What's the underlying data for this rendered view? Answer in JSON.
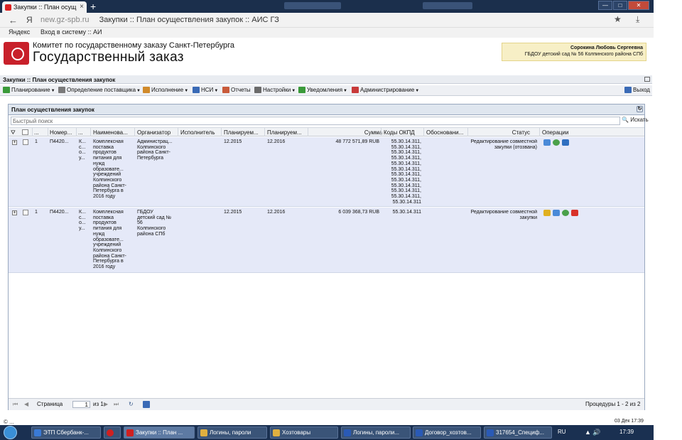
{
  "browser": {
    "tab_title": "Закупки :: План осущ",
    "new_tab": "+",
    "window_buttons": [
      "—",
      "□",
      "✕"
    ],
    "nav_back": "←",
    "ya_icon": "Я",
    "url_host": "new.gz-spb.ru",
    "url_title": "Закупки :: План осуществления закупок :: АИС ГЗ",
    "star": "★",
    "download": "⤓",
    "bookmarks": [
      "Яндекс",
      "Вход в систему :: АИ"
    ]
  },
  "app": {
    "header_line1": "Комитет по государственному заказу Санкт-Петербурга",
    "header_line2": "Государственный заказ",
    "user_name": "Сорокина Любовь Сергеевна",
    "user_org": "ГБДОУ детский сад № 56 Колпинского района СПб"
  },
  "panel_title": "Закупки :: План осуществления закупок",
  "menu": {
    "items": [
      "Планирование",
      "Определение поставщика",
      "Исполнение",
      "НСИ",
      "Отчеты",
      "Настройки",
      "Уведомления",
      "Администрирование"
    ],
    "exit": "Выход",
    "colors": [
      "#3a9a3a",
      "#7a7a7a",
      "#d08a2a",
      "#3a6ab6",
      "#c85a3a",
      "#6a6a6a",
      "#3a9a3a",
      "#c83a3a"
    ]
  },
  "grid": {
    "title": "План осуществления закупок",
    "search_placeholder": "Быстрый поиск",
    "search_button": "Искать",
    "columns": [
      "...",
      "Номер...",
      "...",
      "Наименова...",
      "Организатор",
      "Исполнитель",
      "Планируем...",
      "Планируем...",
      "Сумма",
      "Коды ОКПД",
      "Обосновани...",
      "Статус",
      "Операции"
    ],
    "rows": [
      {
        "num": "1",
        "number": "П4420...",
        "extra": "К... с... о... у...",
        "name": "Комплексная поставка продуктов питания для нужд образовате... учреждений Колпинского района Санкт-Петербурга в 2016 году",
        "organizer": "Администрац... Колпинского района Санкт-Петербурга",
        "executor": "",
        "plan1": "12.2015",
        "plan2": "12.2016",
        "sum": "48 772 571,89 RUB",
        "okpd": "55.30.14.311, 55.30.14.311, 55.30.14.311, 55.30.14.311, 55.30.14.311, 55.30.14.311, 55.30.14.311, 55.30.14.311, 55.30.14.311, 55.30.14.311, 55.30.14.311, 55.30.14.311",
        "reason": "",
        "status": "Редактирование совместной закупки (отозвана)",
        "ops": [
          "chart-icon",
          "refresh-icon",
          "list-icon"
        ]
      },
      {
        "num": "1",
        "number": "П4420...",
        "extra": "К... с... о... у...",
        "name": "Комплексная поставка продуктов питания для нужд образовате... учреждений Колпинского района Санкт-Петербурга в 2016 году",
        "organizer": "ГБДОУ детский сад № 56 Колпинского района СПб",
        "executor": "",
        "plan1": "12.2015",
        "plan2": "12.2016",
        "sum": "6 039 368,73 RUB",
        "okpd": "55.30.14.311",
        "reason": "",
        "status": "Редактирование совместной закупки",
        "ops": [
          "approve-icon",
          "chart-icon",
          "refresh-icon",
          "delete-icon"
        ]
      }
    ],
    "pager": {
      "first": "⏮",
      "prev": "◀",
      "page_label": "Страница",
      "page_value": "1",
      "of_label": "из 1",
      "next": "▶",
      "last": "⏭",
      "info": "Процедуры 1 - 2 из 2"
    }
  },
  "status_bar": {
    "left": "© ...",
    "right": "03 Дек 17:39"
  },
  "taskbar": {
    "items": [
      "ЭТП Сбербанк-...",
      "",
      "Закупки :: План ...",
      "Логины, пароли",
      "Хозтовары",
      "Логины, пароли...",
      "Договор_хозтов...",
      "317654_Специф..."
    ],
    "item_colors": [
      "#3a7ad6",
      "#d02020",
      "#d02020",
      "#e0b040",
      "#e0b040",
      "#2a5ab6",
      "#2a5ab6",
      "#2a5ab6"
    ],
    "lang": "RU",
    "clock": "17:39"
  }
}
